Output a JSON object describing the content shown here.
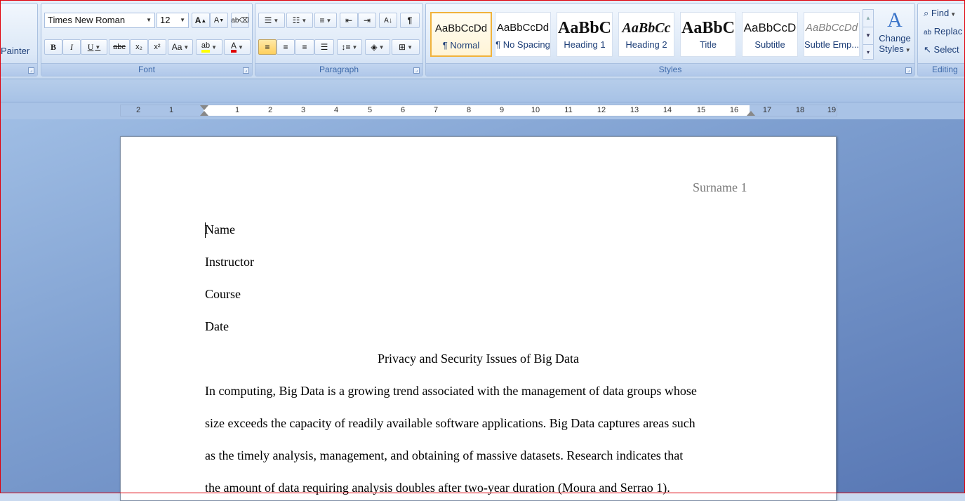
{
  "ribbon": {
    "clipboard": {
      "format_painter_label": "Painter"
    },
    "font": {
      "label": "Font",
      "font_name": "Times New Roman",
      "font_size": "12",
      "grow": "A",
      "shrink": "A",
      "bold": "B",
      "italic": "I",
      "underline": "U",
      "strike": "abc",
      "subscript": "x₂",
      "superscript": "x²",
      "change_case": "Aa",
      "highlight": "ab",
      "font_color": "A"
    },
    "paragraph": {
      "label": "Paragraph",
      "pilcrow": "¶"
    },
    "styles": {
      "label": "Styles",
      "items": [
        {
          "sample": "AaBbCcDd",
          "name": "¶ Normal"
        },
        {
          "sample": "AaBbCcDd",
          "name": "¶ No Spacing"
        },
        {
          "sample": "AaBbC",
          "name": "Heading 1"
        },
        {
          "sample": "AaBbCc",
          "name": "Heading 2"
        },
        {
          "sample": "AaBbC",
          "name": "Title"
        },
        {
          "sample": "AaBbCcD",
          "name": "Subtitle"
        },
        {
          "sample": "AaBbCcDd",
          "name": "Subtle Emp..."
        }
      ],
      "change_styles_line1": "Change",
      "change_styles_line2": "Styles"
    },
    "editing": {
      "label": "Editing",
      "find": "Find",
      "replace": "Replac",
      "select": "Select"
    }
  },
  "ruler": {
    "left_numbers": [
      "2",
      "1"
    ],
    "right_numbers": [
      "1",
      "2",
      "3",
      "4",
      "5",
      "6",
      "7",
      "8",
      "9",
      "10",
      "11",
      "12",
      "13",
      "14",
      "15",
      "16",
      "17",
      "18",
      "19"
    ]
  },
  "document": {
    "header": "Surname 1",
    "name": "Name",
    "instructor": "Instructor",
    "course": "Course",
    "date": "Date",
    "title": "Privacy and Security Issues of Big Data",
    "lines": [
      "In computing, Big Data is a growing trend associated with the management of data groups whose",
      "size exceeds the capacity of readily available software applications. Big Data captures areas such",
      "as the timely analysis, management, and obtaining of massive datasets. Research indicates that",
      "the amount of data requiring analysis doubles after two-year duration (Moura and Serrao 1)."
    ]
  },
  "colors": {
    "highlight": "#ffff00",
    "font_color": "#e00000",
    "selected_style_border": "#f0b23c"
  }
}
